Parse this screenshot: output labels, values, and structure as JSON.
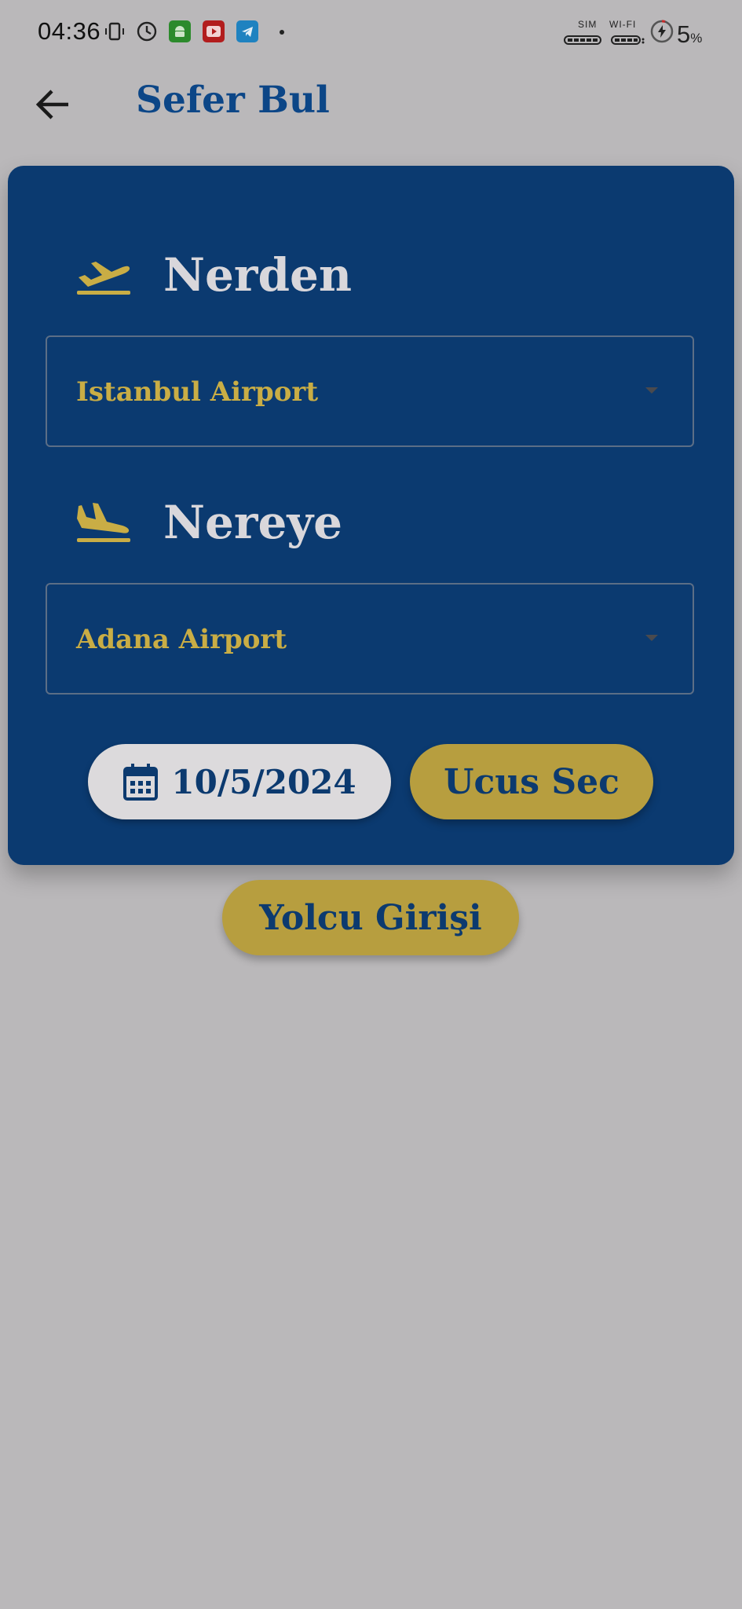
{
  "status_bar": {
    "time": "04:36",
    "sim_label": "SIM",
    "wifi_label": "WI-FI",
    "battery": "5",
    "battery_unit": "%",
    "icons": [
      "vibrate-icon",
      "clock-icon",
      "android-icon",
      "youtube-icon",
      "telegram-icon"
    ]
  },
  "header": {
    "title": "Sefer Bul"
  },
  "form": {
    "from_label": "Nerden",
    "from_value": "Istanbul Airport",
    "to_label": "Nereye",
    "to_value": "Adana Airport",
    "date": "10/5/2024",
    "select_flight_label": "Ucus Sec"
  },
  "passenger_login_label": "Yolcu Girişi",
  "colors": {
    "background": "#bab8ba",
    "card": "#0b3a70",
    "accent_yellow": "#c9ad45",
    "title_blue": "#0c4687"
  }
}
